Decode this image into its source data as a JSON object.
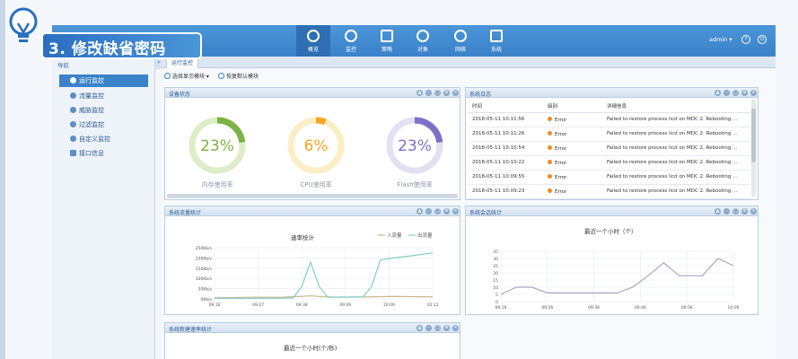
{
  "banner": {
    "text": "3. 修改缺省密码"
  },
  "topnav": {
    "items": [
      {
        "label": "概览",
        "icon": "gauge-icon",
        "active": true
      },
      {
        "label": "监控",
        "icon": "monitor-icon",
        "active": false
      },
      {
        "label": "策略",
        "icon": "shield-icon",
        "active": false
      },
      {
        "label": "对象",
        "icon": "share-icon",
        "active": false
      },
      {
        "label": "网络",
        "icon": "globe-icon",
        "active": false
      },
      {
        "label": "系统",
        "icon": "display-icon",
        "active": false
      }
    ],
    "user": "admin ▾",
    "help": "?",
    "power": "⏻"
  },
  "sidebar": {
    "title": "导航",
    "items": [
      {
        "label": "运行监控",
        "active": true
      },
      {
        "label": "流量监控",
        "active": false
      },
      {
        "label": "威胁监控",
        "active": false
      },
      {
        "label": "过滤监控",
        "active": false
      },
      {
        "label": "自定义监控",
        "active": false
      },
      {
        "label": "接口信息",
        "active": false
      }
    ]
  },
  "tab": {
    "label": "运行监控"
  },
  "toolbar": {
    "select_modules": "选择显示模块 ▾",
    "restore_default": "恢复默认模块"
  },
  "device_status": {
    "title": "设备状态",
    "gauges": [
      {
        "value_text": "23%",
        "value": 23,
        "label": "内存使用率",
        "color": "#7cb342",
        "track": "#dcedc8"
      },
      {
        "value_text": "6%",
        "value": 6,
        "label": "CPU使用率",
        "color": "#f5a623",
        "track": "#fbeec4"
      },
      {
        "value_text": "23%",
        "value": 23,
        "label": "Flash使用率",
        "color": "#7e70c8",
        "track": "#e3e0f3"
      }
    ]
  },
  "system_log": {
    "title": "系统日志",
    "columns": [
      "时间",
      "级别",
      "详细信息"
    ],
    "rows": [
      [
        "2018-05-11 10:11:56",
        "Error",
        "Failed to restore process licd on MDC 2. Rebooting ..."
      ],
      [
        "2018-05-11 10:11:26",
        "Error",
        "Failed to restore process licd on MDC 2. Rebooting ..."
      ],
      [
        "2018-05-11 10:10:54",
        "Error",
        "Failed to restore process licd on MDC 2. Rebooting ..."
      ],
      [
        "2018-05-11 10:10:22",
        "Error",
        "Failed to restore process licd on MDC 2. Rebooting ..."
      ],
      [
        "2018-05-11 10:09:55",
        "Error",
        "Failed to restore process licd on MDC 2. Rebooting ..."
      ],
      [
        "2018-05-11 10:09:23",
        "Error",
        "Failed to restore process licd on MDC 2. Rebooting ..."
      ]
    ]
  },
  "traffic": {
    "title": "系统流量统计",
    "chart_title": "速率统计"
  },
  "sessions": {
    "title": "系统会话统计",
    "chart_title": "最近一个小时（个）"
  },
  "new_sessions": {
    "title": "系统新建速率统计",
    "chart_title": "最近一个小时(个/秒)"
  },
  "chart_data": [
    {
      "type": "line",
      "title": "速率统计",
      "x": [
        "09:16",
        "09:27",
        "09:38",
        "09:49",
        "10:00",
        "10:11"
      ],
      "yticks": [
        "250Kb/s",
        "200Kb/s",
        "150Kb/s",
        "100Kb/s",
        "50Kb/s",
        "0Kb/s"
      ],
      "ylim": [
        0,
        250
      ],
      "series": [
        {
          "name": "入流量",
          "color": "#c8b98a",
          "points": [
            [
              0,
              5
            ],
            [
              8,
              8
            ],
            [
              15,
              8
            ],
            [
              20,
              12
            ],
            [
              22,
              15
            ],
            [
              25,
              10
            ],
            [
              30,
              8
            ],
            [
              36,
              10
            ],
            [
              41,
              12
            ],
            [
              45,
              11
            ],
            [
              50,
              10
            ]
          ]
        },
        {
          "name": "出流量",
          "color": "#7fd0c8",
          "points": [
            [
              0,
              2
            ],
            [
              8,
              3
            ],
            [
              15,
              3
            ],
            [
              18,
              5
            ],
            [
              20,
              60
            ],
            [
              22,
              180
            ],
            [
              24,
              60
            ],
            [
              26,
              8
            ],
            [
              34,
              10
            ],
            [
              36,
              60
            ],
            [
              38,
              190
            ],
            [
              41,
              200
            ],
            [
              45,
              210
            ],
            [
              50,
              225
            ]
          ]
        }
      ],
      "xmax": 50
    },
    {
      "type": "line",
      "title": "最近一个小时（个）",
      "x": [
        "09:16",
        "09:26",
        "09:36",
        "09:46",
        "09:56",
        "10:06"
      ],
      "yticks": [
        "35",
        "30",
        "25",
        "20",
        "15",
        "10",
        "5",
        "0"
      ],
      "ylim": [
        0,
        35
      ],
      "series": [
        {
          "name": "",
          "color": "#a7a7c4",
          "points": [
            [
              0,
              5
            ],
            [
              4,
              10
            ],
            [
              8,
              10
            ],
            [
              12,
              6
            ],
            [
              18,
              6
            ],
            [
              24,
              6
            ],
            [
              30,
              6
            ],
            [
              34,
              10
            ],
            [
              38,
              18
            ],
            [
              42,
              27
            ],
            [
              46,
              18
            ],
            [
              52,
              18
            ],
            [
              56,
              30
            ],
            [
              60,
              25
            ]
          ]
        }
      ],
      "xmax": 60
    }
  ]
}
